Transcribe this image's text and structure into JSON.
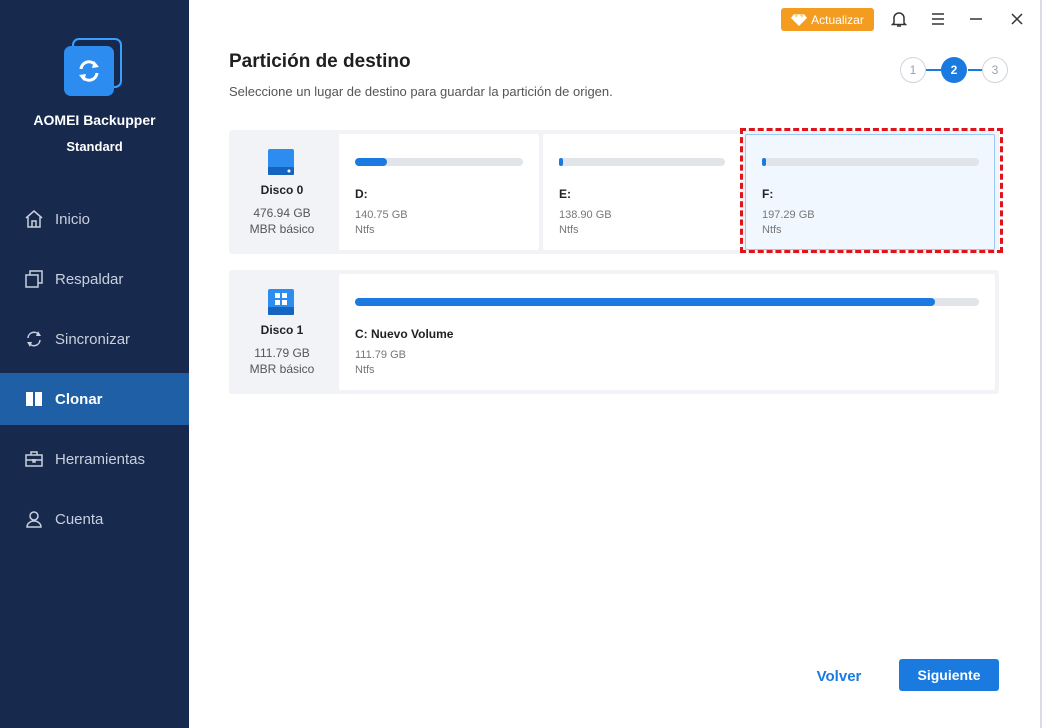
{
  "app": {
    "name": "AOMEI Backupper",
    "edition": "Standard"
  },
  "sidebar": {
    "items": [
      {
        "label": "Inicio",
        "icon": "home-icon",
        "active": false
      },
      {
        "label": "Respaldar",
        "icon": "backup-icon",
        "active": false
      },
      {
        "label": "Sincronizar",
        "icon": "sync-icon",
        "active": false
      },
      {
        "label": "Clonar",
        "icon": "clone-icon",
        "active": true
      },
      {
        "label": "Herramientas",
        "icon": "toolbox-icon",
        "active": false
      },
      {
        "label": "Cuenta",
        "icon": "user-icon",
        "active": false
      }
    ]
  },
  "topbar": {
    "upgrade_label": "Actualizar"
  },
  "page": {
    "title": "Partición de destino",
    "subtitle": "Seleccione un lugar de destino para guardar la partición de origen."
  },
  "steps": [
    "1",
    "2",
    "3"
  ],
  "active_step": 2,
  "disks": [
    {
      "name": "Disco 0",
      "size": "476.94 GB",
      "type": "MBR básico",
      "partitions": [
        {
          "label": "D:",
          "size": "140.75 GB",
          "fs": "Ntfs",
          "used_fraction": 0.19,
          "selected": false
        },
        {
          "label": "E:",
          "size": "138.90 GB",
          "fs": "Ntfs",
          "used_fraction": 0.02,
          "selected": false
        },
        {
          "label": "F:",
          "size": "197.29 GB",
          "fs": "Ntfs",
          "used_fraction": 0.02,
          "selected": true
        }
      ]
    },
    {
      "name": "Disco 1",
      "size": "111.79 GB",
      "type": "MBR básico",
      "partitions": [
        {
          "label": "C: Nuevo Volume",
          "size": "111.79 GB",
          "fs": "Ntfs",
          "used_fraction": 0.93,
          "selected": false
        }
      ]
    }
  ],
  "buttons": {
    "back": "Volver",
    "next": "Siguiente"
  },
  "colors": {
    "sidebar_bg": "#17294d",
    "accent": "#1a7ae0",
    "upgrade": "#f39c1f",
    "selection_outline": "#e0131b"
  }
}
